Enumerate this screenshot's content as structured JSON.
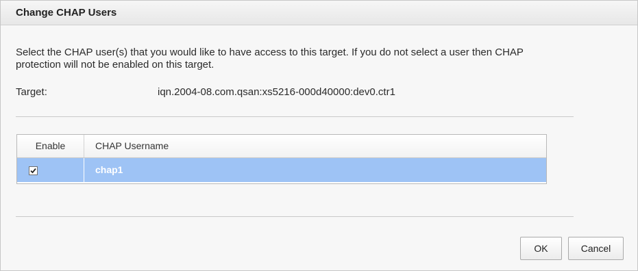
{
  "dialog": {
    "title": "Change CHAP Users",
    "description": "Select the CHAP user(s) that you would like to have access to this target. If you do not select a user then CHAP protection will not be enabled on this target.",
    "target_label": "Target:",
    "target_value": "iqn.2004-08.com.qsan:xs5216-000d40000:dev0.ctr1"
  },
  "grid": {
    "columns": [
      "Enable",
      "CHAP Username"
    ],
    "rows": [
      {
        "enabled": true,
        "username": "chap1",
        "selected": true
      }
    ]
  },
  "buttons": {
    "ok_label": "OK",
    "cancel_label": "Cancel"
  },
  "colors": {
    "selected_row": "#9ec3f5",
    "selected_text": "#ffffff"
  },
  "icons": {
    "checkbox": "check-icon"
  }
}
